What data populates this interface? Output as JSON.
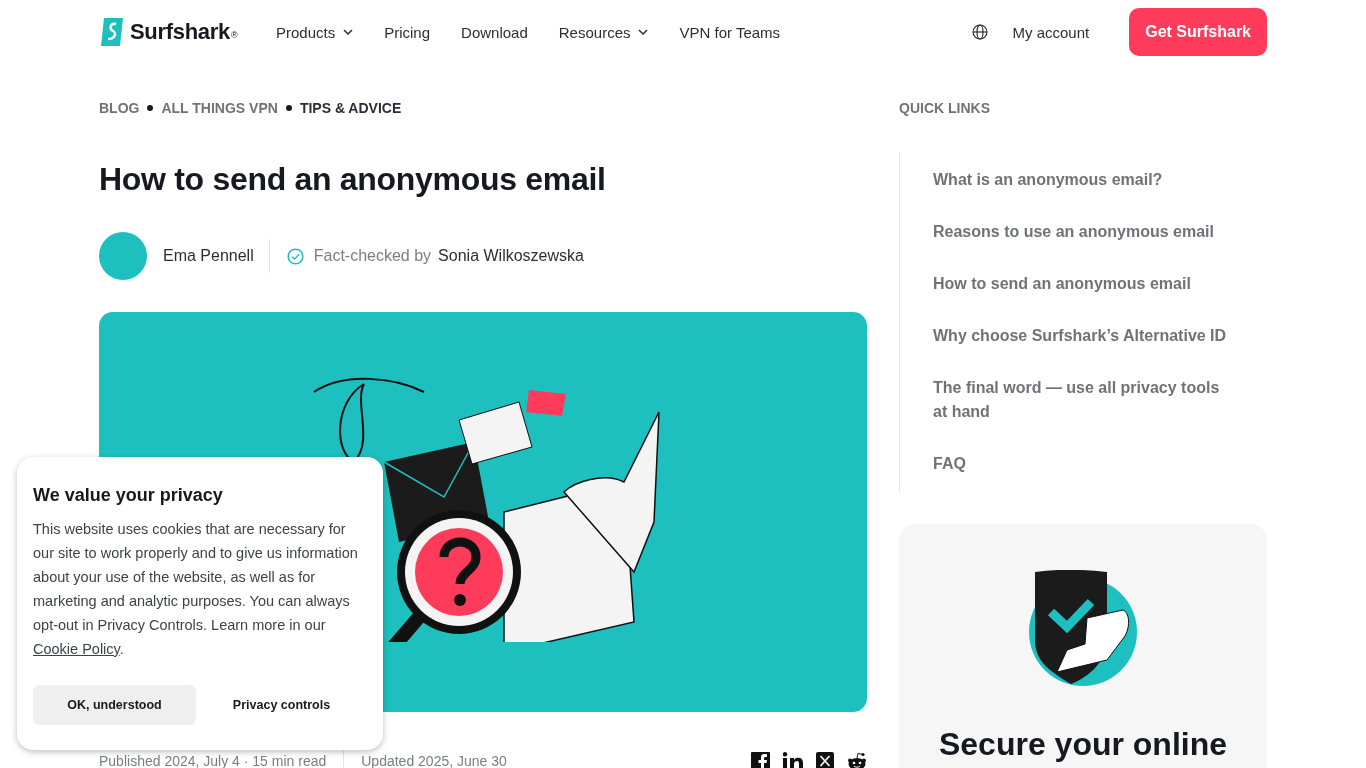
{
  "header": {
    "logo": "Surfshark",
    "logo_mark": "®",
    "nav": [
      {
        "label": "Products",
        "dropdown": true
      },
      {
        "label": "Pricing",
        "dropdown": false
      },
      {
        "label": "Download",
        "dropdown": false
      },
      {
        "label": "Resources",
        "dropdown": true
      },
      {
        "label": "VPN for Teams",
        "dropdown": false
      }
    ],
    "account": "My account",
    "cta": "Get Surfshark"
  },
  "breadcrumb": [
    {
      "label": "BLOG",
      "selected": false
    },
    {
      "label": "ALL THINGS VPN",
      "selected": false
    },
    {
      "label": "TIPS & ADVICE",
      "selected": true
    }
  ],
  "article": {
    "title": "How to send an anonymous email",
    "author": "Ema Pennell",
    "fact_check_label": "Fact-checked by",
    "fact_checker": "Sonia Wilkoszewska",
    "published": "Published 2024, July 4 · 15 min read",
    "updated": "Updated 2025, June 30"
  },
  "quick_links": {
    "heading": "QUICK LINKS",
    "items": [
      "What is an anonymous email?",
      "Reasons to use an anonymous email",
      "How to send an anonymous email",
      "Why choose Surfshark’s Alternative ID",
      "The final word — use all privacy tools at hand",
      "FAQ"
    ]
  },
  "promo": {
    "title": "Secure your online"
  },
  "cookie_banner": {
    "title": "We value your privacy",
    "text": "This website uses cookies that are necessary for our site to work properly and to give us information about your use of the website, as well as for marketing and analytic purposes. You can always opt-out in Privacy Controls. Learn more in our",
    "link": "Cookie Policy",
    "end": ".",
    "accept": "OK, understood",
    "controls": "Privacy controls"
  }
}
